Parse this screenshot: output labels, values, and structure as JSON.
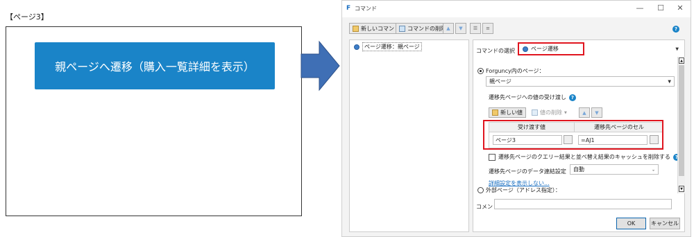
{
  "left_page": {
    "label": "【ページ3】",
    "button_label": "親ページへ遷移（購入一覧詳細を表示）",
    "button_color": "#1a84c8"
  },
  "dialog": {
    "app_icon": "F",
    "title": "コマンド",
    "window_controls": {
      "minimize": "—",
      "maximize": "☐",
      "close": "✕"
    },
    "toolbar": {
      "new_command": "新しいコマンド",
      "delete_command": "コマンドの削除",
      "help_glyph": "?"
    },
    "command_list": [
      "ページ遷移：親ページ"
    ],
    "command_select_label": "コマンドの選択：",
    "command_select_value": "ページ遷移",
    "radio_internal_label": "Forguncy内のページ：",
    "page_select_value": "親ページ",
    "pass_values_label": "遷移先ページへの値の受け渡し",
    "new_value_button": "新しい値",
    "delete_value_button": "値の削除",
    "grid_headers": [
      "受け渡す値",
      "遷移先ページのセル"
    ],
    "grid_row": {
      "value": "ページ3",
      "target_cell": "=AJ1"
    },
    "cache_checkbox_label": "遷移先ページのクエリー結果と並べ替え結果のキャッシュを削除する",
    "data_link_label": "遷移先ページのデータ連結設定",
    "data_link_value": "自動",
    "hide_details_link": "詳細設定を表示しない...",
    "radio_external_label": "外部ページ（アドレス指定）：",
    "comment_label": "コメント",
    "comment_value": "",
    "ok_button": "OK",
    "cancel_button": "キャンセル",
    "accent_color": "#e0141e"
  }
}
